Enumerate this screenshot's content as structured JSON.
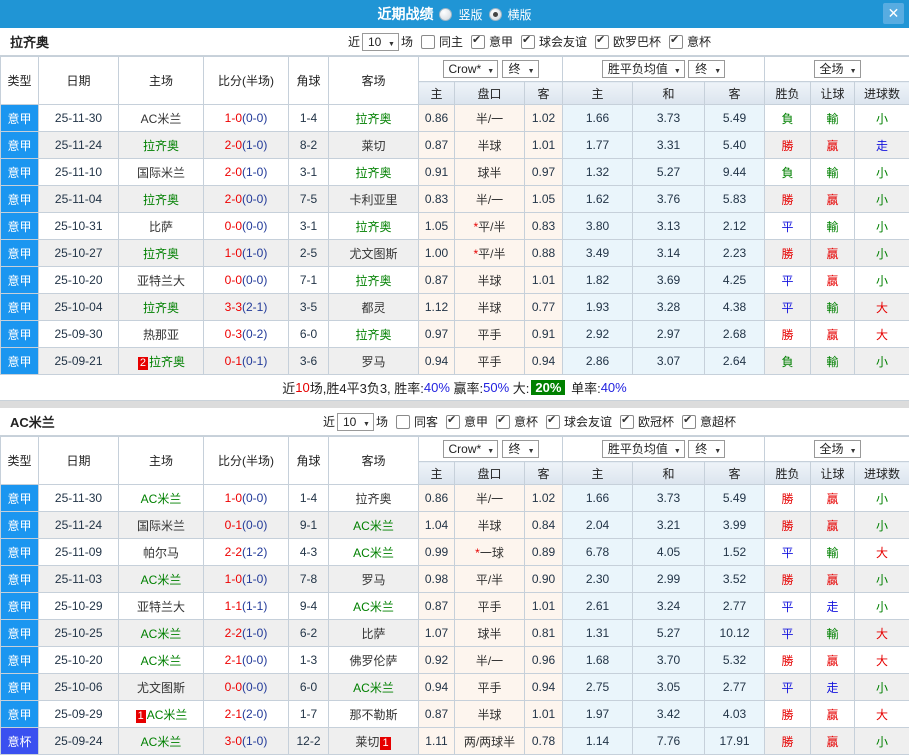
{
  "colors": {
    "titlebar": "#2095d5",
    "league_badge": "#1b96f0",
    "cup_badge": "#3a50f0",
    "win_red": "#e60000",
    "lose_green": "#008000",
    "draw_blue": "#1414dd",
    "team_green": "#008000",
    "big_rate_bg": "#008000"
  },
  "titlebar": {
    "title": "近期战绩",
    "radio_vertical": "竖版",
    "radio_horizontal": "横版",
    "close": "✕"
  },
  "columns": {
    "type": "类型",
    "date": "日期",
    "home": "主场",
    "score": "比分(半场)",
    "corner": "角球",
    "away": "客场",
    "h": "主",
    "handicap": "盘口",
    "a": "客",
    "h2": "主",
    "draw": "和",
    "a2": "客",
    "result": "胜负",
    "handicap_result": "让球",
    "goals": "进球数"
  },
  "sections": [
    {
      "team": "拉齐奥",
      "filter": {
        "near": "近",
        "count": "10",
        "games": "场",
        "same": "同主",
        "leagues": [
          "意甲",
          "球会友谊",
          "欧罗巴杯",
          "意杯"
        ]
      },
      "dropdowns": {
        "odds": "Crow*",
        "final_a": "终",
        "avg": "胜平负均值",
        "final_b": "终",
        "scope": "全场"
      },
      "rows": [
        {
          "lg": "意甲",
          "lgc": "",
          "date": "25-11-30",
          "hb": "",
          "home": "AC米兰",
          "hcls": "",
          "score": "1-0",
          "half": "(0-0)",
          "corner": "1-4",
          "away": "拉齐奥",
          "ab": "",
          "acls": "green",
          "c1": "0.86",
          "star": "",
          "hc": "半/一",
          "c2": "1.02",
          "e1": "1.66",
          "e2": "3.73",
          "e3": "5.49",
          "r1": "負",
          "r1c": "green",
          "r2": "輸",
          "r2c": "green",
          "r3": "小",
          "r3c": "green"
        },
        {
          "lg": "意甲",
          "lgc": "",
          "date": "25-11-24",
          "hb": "",
          "home": "拉齐奥",
          "hcls": "green",
          "score": "2-0",
          "half": "(1-0)",
          "corner": "8-2",
          "away": "莱切",
          "ab": "",
          "acls": "",
          "c1": "0.87",
          "star": "",
          "hc": "半球",
          "c2": "1.01",
          "e1": "1.77",
          "e2": "3.31",
          "e3": "5.40",
          "r1": "勝",
          "r1c": "red",
          "r2": "贏",
          "r2c": "red",
          "r3": "走",
          "r3c": "blue"
        },
        {
          "lg": "意甲",
          "lgc": "",
          "date": "25-11-10",
          "hb": "",
          "home": "国际米兰",
          "hcls": "",
          "score": "2-0",
          "half": "(1-0)",
          "corner": "3-1",
          "away": "拉齐奥",
          "ab": "",
          "acls": "green",
          "c1": "0.91",
          "star": "",
          "hc": "球半",
          "c2": "0.97",
          "e1": "1.32",
          "e2": "5.27",
          "e3": "9.44",
          "r1": "負",
          "r1c": "green",
          "r2": "輸",
          "r2c": "green",
          "r3": "小",
          "r3c": "green"
        },
        {
          "lg": "意甲",
          "lgc": "",
          "date": "25-11-04",
          "hb": "",
          "home": "拉齐奥",
          "hcls": "green",
          "score": "2-0",
          "half": "(0-0)",
          "corner": "7-5",
          "away": "卡利亚里",
          "ab": "",
          "acls": "",
          "c1": "0.83",
          "star": "",
          "hc": "半/一",
          "c2": "1.05",
          "e1": "1.62",
          "e2": "3.76",
          "e3": "5.83",
          "r1": "勝",
          "r1c": "red",
          "r2": "贏",
          "r2c": "red",
          "r3": "小",
          "r3c": "green"
        },
        {
          "lg": "意甲",
          "lgc": "",
          "date": "25-10-31",
          "hb": "",
          "home": "比萨",
          "hcls": "",
          "score": "0-0",
          "half": "(0-0)",
          "corner": "3-1",
          "away": "拉齐奥",
          "ab": "",
          "acls": "green",
          "c1": "1.05",
          "star": "*",
          "hc": "平/半",
          "c2": "0.83",
          "e1": "3.80",
          "e2": "3.13",
          "e3": "2.12",
          "r1": "平",
          "r1c": "blue",
          "r2": "輸",
          "r2c": "green",
          "r3": "小",
          "r3c": "green"
        },
        {
          "lg": "意甲",
          "lgc": "",
          "date": "25-10-27",
          "hb": "",
          "home": "拉齐奥",
          "hcls": "green",
          "score": "1-0",
          "half": "(1-0)",
          "corner": "2-5",
          "away": "尤文图斯",
          "ab": "",
          "acls": "",
          "c1": "1.00",
          "star": "*",
          "hc": "平/半",
          "c2": "0.88",
          "e1": "3.49",
          "e2": "3.14",
          "e3": "2.23",
          "r1": "勝",
          "r1c": "red",
          "r2": "贏",
          "r2c": "red",
          "r3": "小",
          "r3c": "green"
        },
        {
          "lg": "意甲",
          "lgc": "",
          "date": "25-10-20",
          "hb": "",
          "home": "亚特兰大",
          "hcls": "",
          "score": "0-0",
          "half": "(0-0)",
          "corner": "7-1",
          "away": "拉齐奥",
          "ab": "",
          "acls": "green",
          "c1": "0.87",
          "star": "",
          "hc": "半球",
          "c2": "1.01",
          "e1": "1.82",
          "e2": "3.69",
          "e3": "4.25",
          "r1": "平",
          "r1c": "blue",
          "r2": "贏",
          "r2c": "red",
          "r3": "小",
          "r3c": "green"
        },
        {
          "lg": "意甲",
          "lgc": "",
          "date": "25-10-04",
          "hb": "",
          "home": "拉齐奥",
          "hcls": "green",
          "score": "3-3",
          "half": "(2-1)",
          "corner": "3-5",
          "away": "都灵",
          "ab": "",
          "acls": "",
          "c1": "1.12",
          "star": "",
          "hc": "半球",
          "c2": "0.77",
          "e1": "1.93",
          "e2": "3.28",
          "e3": "4.38",
          "r1": "平",
          "r1c": "blue",
          "r2": "輸",
          "r2c": "green",
          "r3": "大",
          "r3c": "red"
        },
        {
          "lg": "意甲",
          "lgc": "",
          "date": "25-09-30",
          "hb": "",
          "home": "热那亚",
          "hcls": "",
          "score": "0-3",
          "half": "(0-2)",
          "corner": "6-0",
          "away": "拉齐奥",
          "ab": "",
          "acls": "green",
          "c1": "0.97",
          "star": "",
          "hc": "平手",
          "c2": "0.91",
          "e1": "2.92",
          "e2": "2.97",
          "e3": "2.68",
          "r1": "勝",
          "r1c": "red",
          "r2": "贏",
          "r2c": "red",
          "r3": "大",
          "r3c": "red"
        },
        {
          "lg": "意甲",
          "lgc": "",
          "date": "25-09-21",
          "hb": "2",
          "home": "拉齐奥",
          "hcls": "green",
          "score": "0-1",
          "half": "(0-1)",
          "corner": "3-6",
          "away": "罗马",
          "ab": "",
          "acls": "",
          "c1": "0.94",
          "star": "",
          "hc": "平手",
          "c2": "0.94",
          "e1": "2.86",
          "e2": "3.07",
          "e3": "2.64",
          "r1": "負",
          "r1c": "green",
          "r2": "輸",
          "r2c": "green",
          "r3": "小",
          "r3c": "green"
        }
      ],
      "summary": [
        {
          "t": "近"
        },
        {
          "t": "10",
          "c": "red"
        },
        {
          "t": "场,胜4平3负3, 胜率:"
        },
        {
          "t": "40%",
          "c": "blue"
        },
        {
          "t": " 赢率:"
        },
        {
          "t": "50%",
          "c": "blue"
        },
        {
          "t": " 大:"
        },
        {
          "t": "20%",
          "c": "greenbg"
        },
        {
          "t": " 单率:"
        },
        {
          "t": "40%",
          "c": "blue"
        }
      ]
    },
    {
      "team": "AC米兰",
      "filter": {
        "near": "近",
        "count": "10",
        "games": "场",
        "same": "同客",
        "leagues": [
          "意甲",
          "意杯",
          "球会友谊",
          "欧冠杯",
          "意超杯"
        ]
      },
      "dropdowns": {
        "odds": "Crow*",
        "final_a": "终",
        "avg": "胜平负均值",
        "final_b": "终",
        "scope": "全场"
      },
      "rows": [
        {
          "lg": "意甲",
          "lgc": "",
          "date": "25-11-30",
          "hb": "",
          "home": "AC米兰",
          "hcls": "green",
          "score": "1-0",
          "half": "(0-0)",
          "corner": "1-4",
          "away": "拉齐奥",
          "ab": "",
          "acls": "",
          "c1": "0.86",
          "star": "",
          "hc": "半/一",
          "c2": "1.02",
          "e1": "1.66",
          "e2": "3.73",
          "e3": "5.49",
          "r1": "勝",
          "r1c": "red",
          "r2": "贏",
          "r2c": "red",
          "r3": "小",
          "r3c": "green"
        },
        {
          "lg": "意甲",
          "lgc": "",
          "date": "25-11-24",
          "hb": "",
          "home": "国际米兰",
          "hcls": "",
          "score": "0-1",
          "half": "(0-0)",
          "corner": "9-1",
          "away": "AC米兰",
          "ab": "",
          "acls": "green",
          "c1": "1.04",
          "star": "",
          "hc": "半球",
          "c2": "0.84",
          "e1": "2.04",
          "e2": "3.21",
          "e3": "3.99",
          "r1": "勝",
          "r1c": "red",
          "r2": "贏",
          "r2c": "red",
          "r3": "小",
          "r3c": "green"
        },
        {
          "lg": "意甲",
          "lgc": "",
          "date": "25-11-09",
          "hb": "",
          "home": "帕尔马",
          "hcls": "",
          "score": "2-2",
          "half": "(1-2)",
          "corner": "4-3",
          "away": "AC米兰",
          "ab": "",
          "acls": "green",
          "c1": "0.99",
          "star": "*",
          "hc": "一球",
          "c2": "0.89",
          "e1": "6.78",
          "e2": "4.05",
          "e3": "1.52",
          "r1": "平",
          "r1c": "blue",
          "r2": "輸",
          "r2c": "green",
          "r3": "大",
          "r3c": "red"
        },
        {
          "lg": "意甲",
          "lgc": "",
          "date": "25-11-03",
          "hb": "",
          "home": "AC米兰",
          "hcls": "green",
          "score": "1-0",
          "half": "(1-0)",
          "corner": "7-8",
          "away": "罗马",
          "ab": "",
          "acls": "",
          "c1": "0.98",
          "star": "",
          "hc": "平/半",
          "c2": "0.90",
          "e1": "2.30",
          "e2": "2.99",
          "e3": "3.52",
          "r1": "勝",
          "r1c": "red",
          "r2": "贏",
          "r2c": "red",
          "r3": "小",
          "r3c": "green"
        },
        {
          "lg": "意甲",
          "lgc": "",
          "date": "25-10-29",
          "hb": "",
          "home": "亚特兰大",
          "hcls": "",
          "score": "1-1",
          "half": "(1-1)",
          "corner": "9-4",
          "away": "AC米兰",
          "ab": "",
          "acls": "green",
          "c1": "0.87",
          "star": "",
          "hc": "平手",
          "c2": "1.01",
          "e1": "2.61",
          "e2": "3.24",
          "e3": "2.77",
          "r1": "平",
          "r1c": "blue",
          "r2": "走",
          "r2c": "blue",
          "r3": "小",
          "r3c": "green"
        },
        {
          "lg": "意甲",
          "lgc": "",
          "date": "25-10-25",
          "hb": "",
          "home": "AC米兰",
          "hcls": "green",
          "score": "2-2",
          "half": "(1-0)",
          "corner": "6-2",
          "away": "比萨",
          "ab": "",
          "acls": "",
          "c1": "1.07",
          "star": "",
          "hc": "球半",
          "c2": "0.81",
          "e1": "1.31",
          "e2": "5.27",
          "e3": "10.12",
          "r1": "平",
          "r1c": "blue",
          "r2": "輸",
          "r2c": "green",
          "r3": "大",
          "r3c": "red"
        },
        {
          "lg": "意甲",
          "lgc": "",
          "date": "25-10-20",
          "hb": "",
          "home": "AC米兰",
          "hcls": "green",
          "score": "2-1",
          "half": "(0-0)",
          "corner": "1-3",
          "away": "佛罗伦萨",
          "ab": "",
          "acls": "",
          "c1": "0.92",
          "star": "",
          "hc": "半/一",
          "c2": "0.96",
          "e1": "1.68",
          "e2": "3.70",
          "e3": "5.32",
          "r1": "勝",
          "r1c": "red",
          "r2": "贏",
          "r2c": "red",
          "r3": "大",
          "r3c": "red"
        },
        {
          "lg": "意甲",
          "lgc": "",
          "date": "25-10-06",
          "hb": "",
          "home": "尤文图斯",
          "hcls": "",
          "score": "0-0",
          "half": "(0-0)",
          "corner": "6-0",
          "away": "AC米兰",
          "ab": "",
          "acls": "green",
          "c1": "0.94",
          "star": "",
          "hc": "平手",
          "c2": "0.94",
          "e1": "2.75",
          "e2": "3.05",
          "e3": "2.77",
          "r1": "平",
          "r1c": "blue",
          "r2": "走",
          "r2c": "blue",
          "r3": "小",
          "r3c": "green"
        },
        {
          "lg": "意甲",
          "lgc": "",
          "date": "25-09-29",
          "hb": "1",
          "home": "AC米兰",
          "hcls": "green",
          "score": "2-1",
          "half": "(2-0)",
          "corner": "1-7",
          "away": "那不勒斯",
          "ab": "",
          "acls": "",
          "c1": "0.87",
          "star": "",
          "hc": "半球",
          "c2": "1.01",
          "e1": "1.97",
          "e2": "3.42",
          "e3": "4.03",
          "r1": "勝",
          "r1c": "red",
          "r2": "贏",
          "r2c": "red",
          "r3": "大",
          "r3c": "red"
        },
        {
          "lg": "意杯",
          "lgc": "cup",
          "date": "25-09-24",
          "hb": "",
          "home": "AC米兰",
          "hcls": "green",
          "score": "3-0",
          "half": "(1-0)",
          "corner": "12-2",
          "away": "莱切",
          "ab": "1",
          "acls": "",
          "c1": "1.11",
          "star": "",
          "hc": "两/两球半",
          "c2": "0.78",
          "e1": "1.14",
          "e2": "7.76",
          "e3": "17.91",
          "r1": "勝",
          "r1c": "red",
          "r2": "贏",
          "r2c": "red",
          "r3": "小",
          "r3c": "green"
        }
      ],
      "summary": []
    }
  ]
}
